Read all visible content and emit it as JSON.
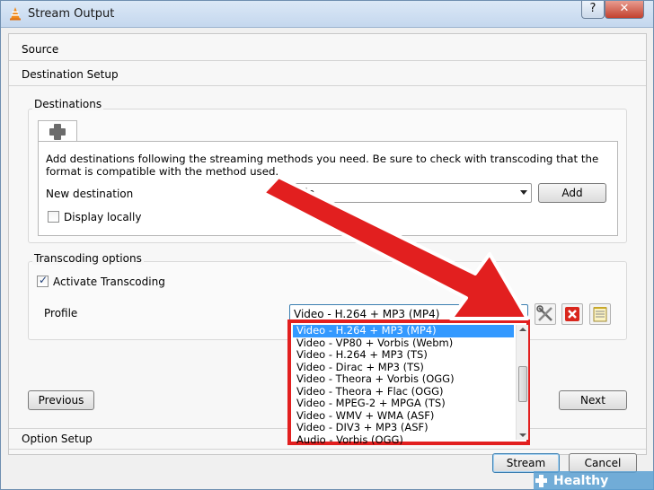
{
  "window": {
    "title": "Stream Output",
    "help_glyph": "?",
    "close_glyph": "✕"
  },
  "sections": {
    "source": "Source",
    "destination_setup": "Destination Setup",
    "option_setup": "Option Setup"
  },
  "destinations": {
    "group_label": "Destinations",
    "info_text": "Add destinations following the streaming methods you need. Be sure to check with transcoding that the format is compatible with the method used.",
    "new_destination_label": "New destination",
    "new_destination_value": "File",
    "add_label": "Add",
    "display_locally_label": "Display locally",
    "display_locally_checked": false
  },
  "transcoding": {
    "group_label": "Transcoding options",
    "activate_label": "Activate Transcoding",
    "activate_checked": true,
    "profile_label": "Profile",
    "profile_value": "Video - H.264 + MP3 (MP4)",
    "profile_options": [
      "Video - H.264 + MP3 (MP4)",
      "Video - VP80 + Vorbis (Webm)",
      "Video - H.264 + MP3 (TS)",
      "Video - Dirac + MP3 (TS)",
      "Video - Theora + Vorbis (OGG)",
      "Video - Theora + Flac (OGG)",
      "Video - MPEG-2 + MPGA (TS)",
      "Video - WMV + WMA (ASF)",
      "Video - DIV3 + MP3 (ASF)",
      "Audio - Vorbis (OGG)"
    ],
    "selected_index": 0
  },
  "nav": {
    "previous_label": "Previous",
    "next_label": "Next"
  },
  "footer": {
    "stream_label": "Stream",
    "cancel_label": "Cancel"
  },
  "watermark": {
    "text": "Healthy Living"
  },
  "colors": {
    "highlight": "#e21f1f",
    "selection": "#3399ff"
  }
}
